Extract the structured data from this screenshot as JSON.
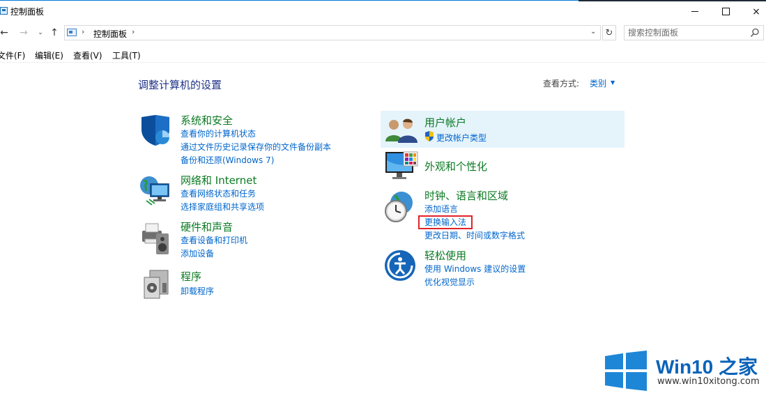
{
  "window": {
    "title": "控制面板",
    "buttons": {
      "minimize": "minimize",
      "maximize": "maximize",
      "close": "×"
    }
  },
  "nav": {
    "back": "←",
    "forward": "→",
    "recent": "⌄",
    "up": "↑",
    "address_sep": "›",
    "address_path": "控制面板",
    "dropdown": "⌄",
    "refresh": "↻",
    "search_placeholder": "搜索控制面板"
  },
  "menu": [
    "文件(F)",
    "编辑(E)",
    "查看(V)",
    "工具(T)"
  ],
  "main": {
    "title": "调整计算机的设置",
    "view_by_label": "查看方式:",
    "view_by_value": "类别",
    "view_by_arrow": "▼"
  },
  "categories_left": [
    {
      "title": "系统和安全",
      "icon": "shield-icon",
      "links": [
        "查看你的计算机状态",
        "通过文件历史记录保存你的文件备份副本",
        "备份和还原(Windows 7)"
      ]
    },
    {
      "title": "网络和 Internet",
      "icon": "network-globe-icon",
      "links": [
        "查看网络状态和任务",
        "选择家庭组和共享选项"
      ]
    },
    {
      "title": "硬件和声音",
      "icon": "printer-speaker-icon",
      "links": [
        "查看设备和打印机",
        "添加设备"
      ]
    },
    {
      "title": "程序",
      "icon": "programs-box-icon",
      "links": [
        "卸载程序"
      ]
    }
  ],
  "categories_right": [
    {
      "title": "用户帐户",
      "icon": "users-icon",
      "links": [
        "更改帐户类型"
      ]
    },
    {
      "title": "外观和个性化",
      "icon": "monitor-personalize-icon",
      "links": []
    },
    {
      "title": "时钟、语言和区域",
      "icon": "clock-globe-icon",
      "links": [
        "添加语言",
        "更换输入法",
        "更改日期、时间或数字格式"
      ]
    },
    {
      "title": "轻松使用",
      "icon": "ease-of-access-icon",
      "links": [
        "使用 Windows 建议的设置",
        "优化视觉显示"
      ]
    }
  ],
  "watermark": {
    "title": "Win10 之家",
    "url": "www.win10xitong.com"
  },
  "colors": {
    "category_green": "#0a7a22",
    "link_blue": "#0066cc",
    "title_blue": "#1e3287",
    "highlight": "#e5f3fb",
    "annotation_red": "#e0232a"
  }
}
